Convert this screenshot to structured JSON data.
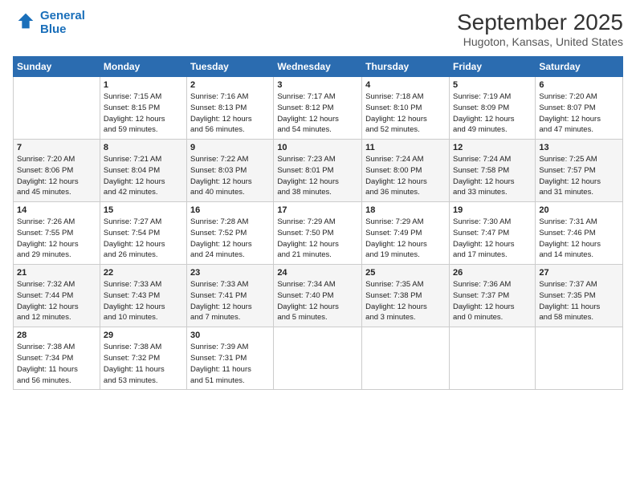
{
  "header": {
    "logo_line1": "General",
    "logo_line2": "Blue",
    "month": "September 2025",
    "location": "Hugoton, Kansas, United States"
  },
  "weekdays": [
    "Sunday",
    "Monday",
    "Tuesday",
    "Wednesday",
    "Thursday",
    "Friday",
    "Saturday"
  ],
  "weeks": [
    [
      {
        "day": "",
        "info": ""
      },
      {
        "day": "1",
        "info": "Sunrise: 7:15 AM\nSunset: 8:15 PM\nDaylight: 12 hours\nand 59 minutes."
      },
      {
        "day": "2",
        "info": "Sunrise: 7:16 AM\nSunset: 8:13 PM\nDaylight: 12 hours\nand 56 minutes."
      },
      {
        "day": "3",
        "info": "Sunrise: 7:17 AM\nSunset: 8:12 PM\nDaylight: 12 hours\nand 54 minutes."
      },
      {
        "day": "4",
        "info": "Sunrise: 7:18 AM\nSunset: 8:10 PM\nDaylight: 12 hours\nand 52 minutes."
      },
      {
        "day": "5",
        "info": "Sunrise: 7:19 AM\nSunset: 8:09 PM\nDaylight: 12 hours\nand 49 minutes."
      },
      {
        "day": "6",
        "info": "Sunrise: 7:20 AM\nSunset: 8:07 PM\nDaylight: 12 hours\nand 47 minutes."
      }
    ],
    [
      {
        "day": "7",
        "info": "Sunrise: 7:20 AM\nSunset: 8:06 PM\nDaylight: 12 hours\nand 45 minutes."
      },
      {
        "day": "8",
        "info": "Sunrise: 7:21 AM\nSunset: 8:04 PM\nDaylight: 12 hours\nand 42 minutes."
      },
      {
        "day": "9",
        "info": "Sunrise: 7:22 AM\nSunset: 8:03 PM\nDaylight: 12 hours\nand 40 minutes."
      },
      {
        "day": "10",
        "info": "Sunrise: 7:23 AM\nSunset: 8:01 PM\nDaylight: 12 hours\nand 38 minutes."
      },
      {
        "day": "11",
        "info": "Sunrise: 7:24 AM\nSunset: 8:00 PM\nDaylight: 12 hours\nand 36 minutes."
      },
      {
        "day": "12",
        "info": "Sunrise: 7:24 AM\nSunset: 7:58 PM\nDaylight: 12 hours\nand 33 minutes."
      },
      {
        "day": "13",
        "info": "Sunrise: 7:25 AM\nSunset: 7:57 PM\nDaylight: 12 hours\nand 31 minutes."
      }
    ],
    [
      {
        "day": "14",
        "info": "Sunrise: 7:26 AM\nSunset: 7:55 PM\nDaylight: 12 hours\nand 29 minutes."
      },
      {
        "day": "15",
        "info": "Sunrise: 7:27 AM\nSunset: 7:54 PM\nDaylight: 12 hours\nand 26 minutes."
      },
      {
        "day": "16",
        "info": "Sunrise: 7:28 AM\nSunset: 7:52 PM\nDaylight: 12 hours\nand 24 minutes."
      },
      {
        "day": "17",
        "info": "Sunrise: 7:29 AM\nSunset: 7:50 PM\nDaylight: 12 hours\nand 21 minutes."
      },
      {
        "day": "18",
        "info": "Sunrise: 7:29 AM\nSunset: 7:49 PM\nDaylight: 12 hours\nand 19 minutes."
      },
      {
        "day": "19",
        "info": "Sunrise: 7:30 AM\nSunset: 7:47 PM\nDaylight: 12 hours\nand 17 minutes."
      },
      {
        "day": "20",
        "info": "Sunrise: 7:31 AM\nSunset: 7:46 PM\nDaylight: 12 hours\nand 14 minutes."
      }
    ],
    [
      {
        "day": "21",
        "info": "Sunrise: 7:32 AM\nSunset: 7:44 PM\nDaylight: 12 hours\nand 12 minutes."
      },
      {
        "day": "22",
        "info": "Sunrise: 7:33 AM\nSunset: 7:43 PM\nDaylight: 12 hours\nand 10 minutes."
      },
      {
        "day": "23",
        "info": "Sunrise: 7:33 AM\nSunset: 7:41 PM\nDaylight: 12 hours\nand 7 minutes."
      },
      {
        "day": "24",
        "info": "Sunrise: 7:34 AM\nSunset: 7:40 PM\nDaylight: 12 hours\nand 5 minutes."
      },
      {
        "day": "25",
        "info": "Sunrise: 7:35 AM\nSunset: 7:38 PM\nDaylight: 12 hours\nand 3 minutes."
      },
      {
        "day": "26",
        "info": "Sunrise: 7:36 AM\nSunset: 7:37 PM\nDaylight: 12 hours\nand 0 minutes."
      },
      {
        "day": "27",
        "info": "Sunrise: 7:37 AM\nSunset: 7:35 PM\nDaylight: 11 hours\nand 58 minutes."
      }
    ],
    [
      {
        "day": "28",
        "info": "Sunrise: 7:38 AM\nSunset: 7:34 PM\nDaylight: 11 hours\nand 56 minutes."
      },
      {
        "day": "29",
        "info": "Sunrise: 7:38 AM\nSunset: 7:32 PM\nDaylight: 11 hours\nand 53 minutes."
      },
      {
        "day": "30",
        "info": "Sunrise: 7:39 AM\nSunset: 7:31 PM\nDaylight: 11 hours\nand 51 minutes."
      },
      {
        "day": "",
        "info": ""
      },
      {
        "day": "",
        "info": ""
      },
      {
        "day": "",
        "info": ""
      },
      {
        "day": "",
        "info": ""
      }
    ]
  ]
}
